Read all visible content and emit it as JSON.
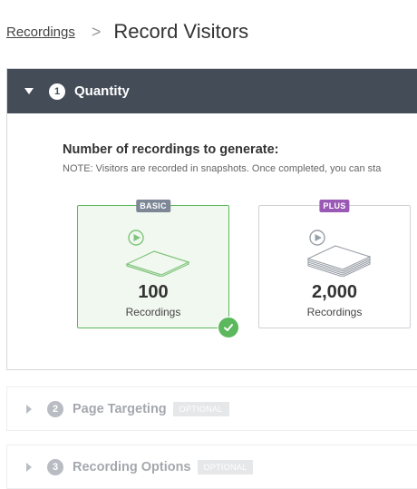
{
  "breadcrumb": {
    "link": "Recordings",
    "separator": ">",
    "title": "Record Visitors"
  },
  "quantity_section": {
    "step": "1",
    "title": "Quantity",
    "heading": "Number of recordings to generate:",
    "note": "NOTE: Visitors are recorded in snapshots. Once completed, you can sta",
    "options": [
      {
        "badge": "BASIC",
        "value": "100",
        "label": "Recordings",
        "selected": true
      },
      {
        "badge": "PLUS",
        "value": "2,000",
        "label": "Recordings",
        "selected": false
      }
    ]
  },
  "page_targeting_section": {
    "step": "2",
    "title": "Page Targeting",
    "tag": "OPTIONAL"
  },
  "recording_options_section": {
    "step": "3",
    "title": "Recording Options",
    "tag": "OPTIONAL"
  },
  "colors": {
    "header_bg": "#444c58",
    "selected_border": "#5cb85c",
    "basic_badge": "#7d8796",
    "plus_badge": "#9b59b6"
  },
  "icons": [
    "caret-down-icon",
    "caret-right-icon",
    "play-icon",
    "stack-icon",
    "check-icon"
  ]
}
